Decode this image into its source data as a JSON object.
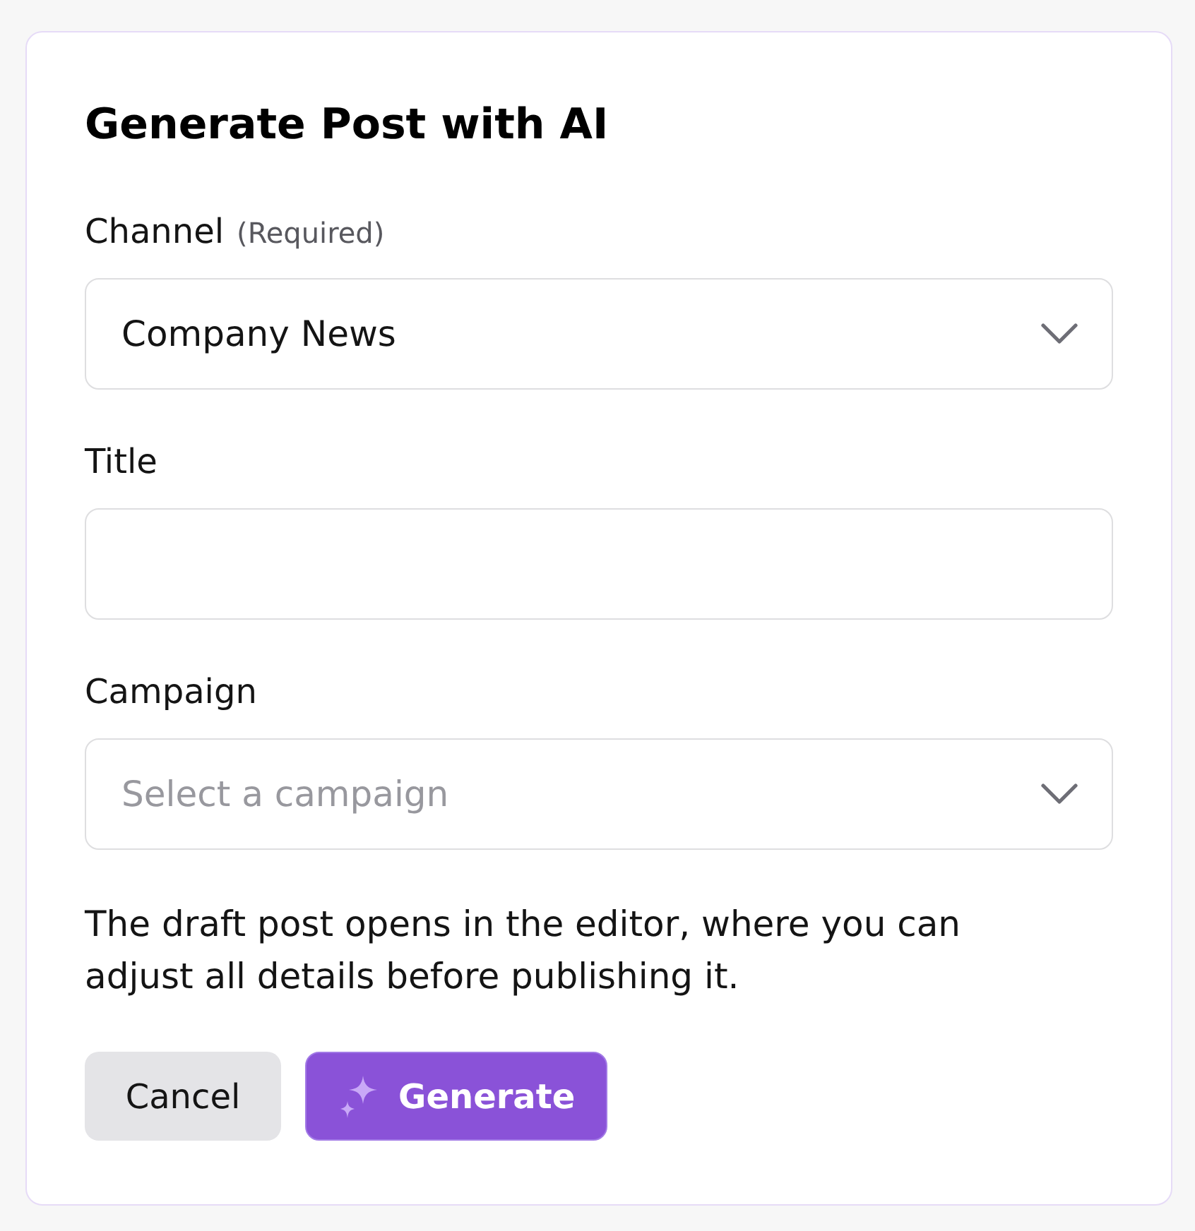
{
  "dialog": {
    "title": "Generate Post with AI",
    "fields": [
      {
        "kind": "select",
        "label": "Channel",
        "note": "(Required)",
        "value": "Company News"
      },
      {
        "kind": "text",
        "label": "Title"
      },
      {
        "kind": "select",
        "label": "Campaign",
        "placeholder": "Select a campaign"
      }
    ],
    "description": "The draft post opens in the editor, where you can adjust all details before publishing it.",
    "buttons": [
      {
        "kind": "secondary",
        "label": "Cancel"
      },
      {
        "kind": "primary",
        "label": "Generate"
      }
    ]
  }
}
